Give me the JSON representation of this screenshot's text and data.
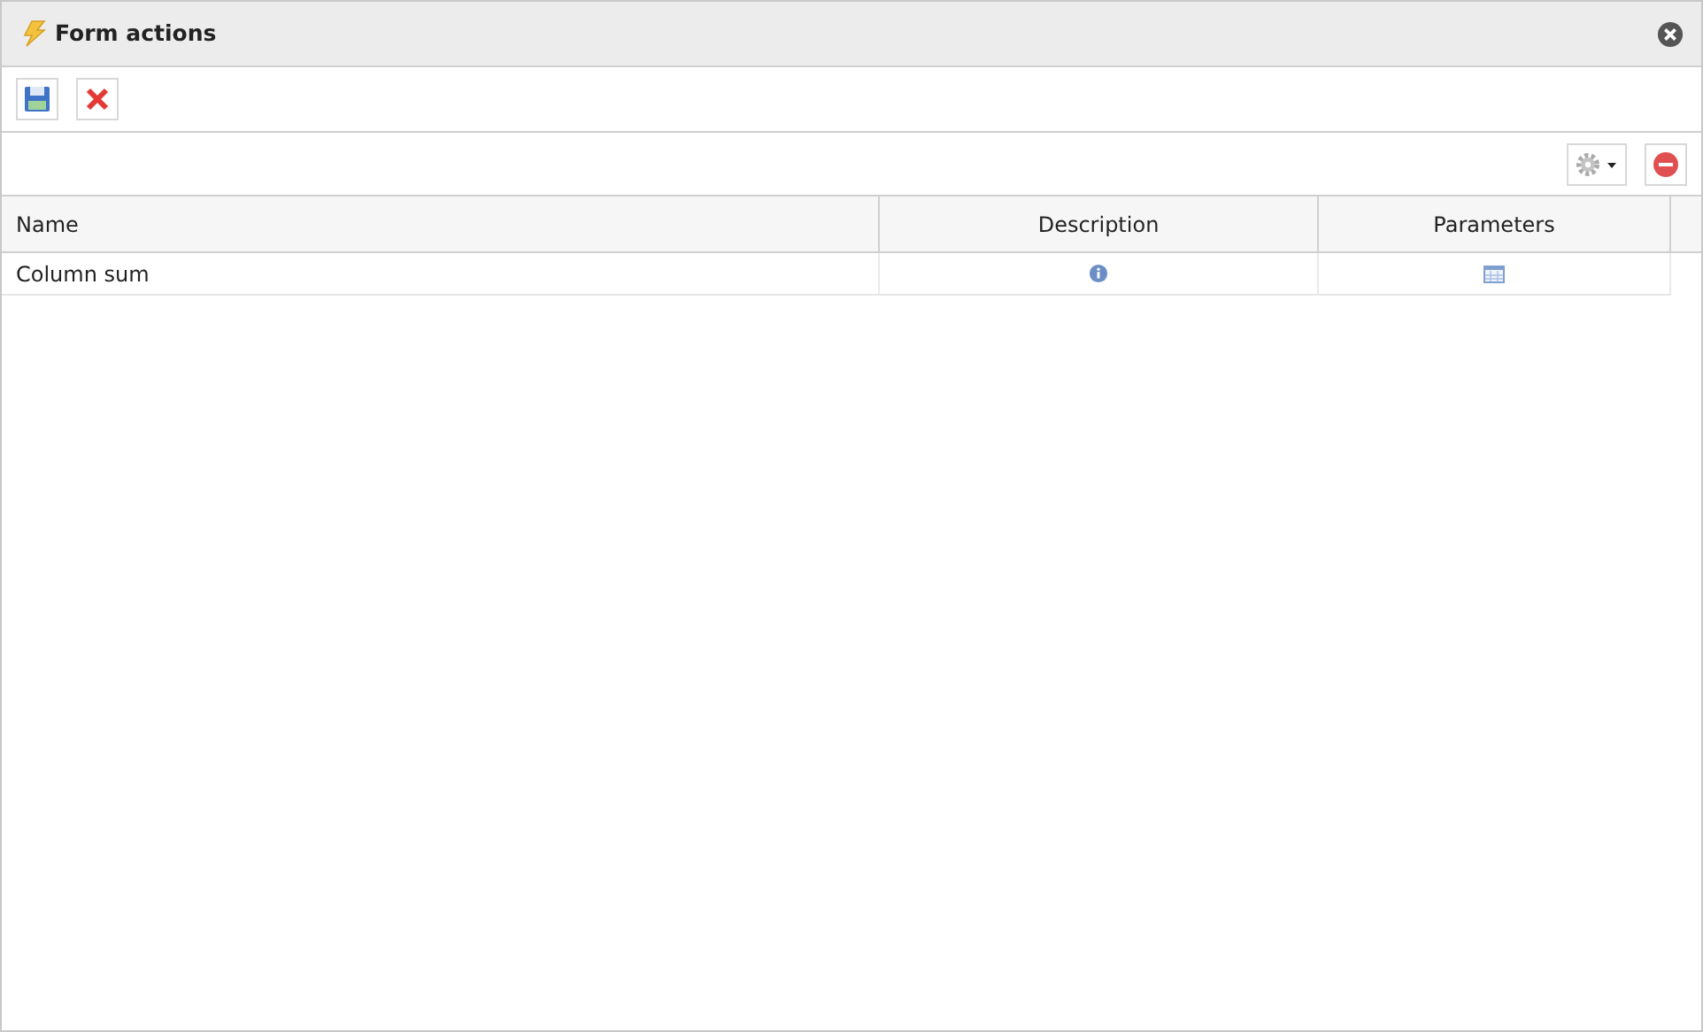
{
  "window": {
    "title": "Form actions"
  },
  "table": {
    "columns": [
      "Name",
      "Description",
      "Parameters"
    ],
    "rows": [
      {
        "name": "Column sum"
      }
    ]
  }
}
